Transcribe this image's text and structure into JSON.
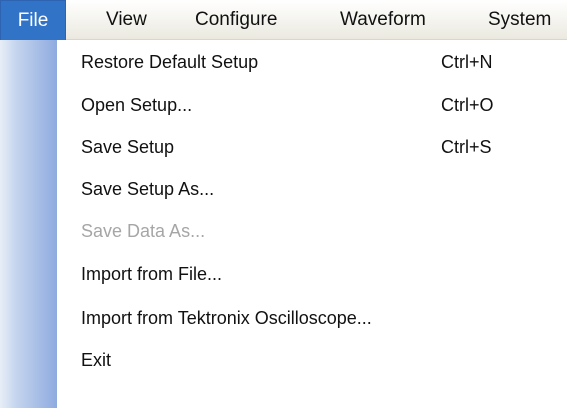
{
  "menubar": {
    "items": [
      {
        "label": "File",
        "active": true
      },
      {
        "label": "View",
        "active": false
      },
      {
        "label": "Configure",
        "active": false
      },
      {
        "label": "Waveform",
        "active": false
      },
      {
        "label": "System",
        "active": false
      }
    ]
  },
  "file_menu": {
    "items": [
      {
        "label": "Restore Default Setup",
        "shortcut": "Ctrl+N",
        "enabled": true
      },
      {
        "label": "Open Setup...",
        "shortcut": "Ctrl+O",
        "enabled": true
      },
      {
        "label": "Save Setup",
        "shortcut": "Ctrl+S",
        "enabled": true
      },
      {
        "label": "Save Setup As...",
        "shortcut": "",
        "enabled": true
      },
      {
        "label": "Save Data As...",
        "shortcut": "",
        "enabled": false
      },
      {
        "label": "Import from File...",
        "shortcut": "",
        "enabled": true
      },
      {
        "label": "Import from Tektronix Oscilloscope...",
        "shortcut": "",
        "enabled": true
      },
      {
        "label": "Exit",
        "shortcut": "",
        "enabled": true
      }
    ]
  },
  "colors": {
    "active_menu_bg": "#3173c6",
    "disabled_text": "#a6a6a6"
  }
}
